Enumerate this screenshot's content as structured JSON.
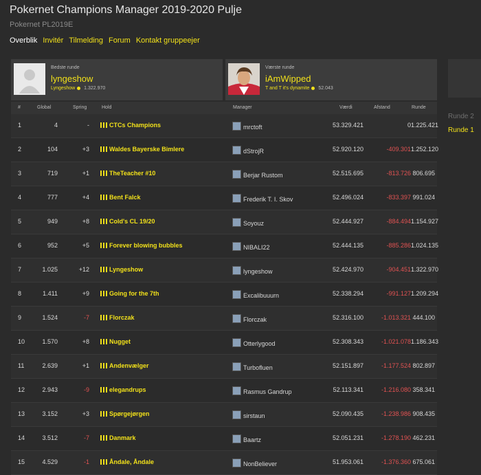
{
  "page": {
    "title": "Pokernet Champions Manager 2019-2020 Pulje",
    "subtitle": "Pokernet PL2019E"
  },
  "nav": {
    "items": [
      "Overblik",
      "Invitér",
      "Tilmelding",
      "Forum",
      "Kontakt gruppeejer"
    ]
  },
  "best": {
    "label": "Bedste runde",
    "name": "lyngeshow",
    "team": "Lyngeshow",
    "points": "1.322.970"
  },
  "worst": {
    "label": "Værste runde",
    "name": "iAmWipped",
    "team": "T and T it's dynamite",
    "points": "52.043"
  },
  "rounds": {
    "round2": "Runde 2",
    "round1": "Runde 1"
  },
  "table": {
    "headers": {
      "rank": "#",
      "global": "Global",
      "spring": "Spring",
      "team": "Hold",
      "manager": "Manager",
      "value": "Værdi",
      "gap": "Afstand",
      "round": "Runde"
    },
    "rows": [
      {
        "rank": "1",
        "global": "4",
        "spring": "-",
        "team": "CTCs Champions",
        "manager": "mrctoft",
        "value": "53.329.421",
        "gap": "0",
        "round": "1.225.421"
      },
      {
        "rank": "2",
        "global": "104",
        "spring": "+3",
        "team": "Waldes Bayerske Bimlere",
        "manager": "dStrojR",
        "value": "52.920.120",
        "gap": "-409.301",
        "round": "1.252.120"
      },
      {
        "rank": "3",
        "global": "719",
        "spring": "+1",
        "team": "TheTeacher #10",
        "manager": "Berjar Rustom",
        "value": "52.515.695",
        "gap": "-813.726",
        "round": "806.695"
      },
      {
        "rank": "4",
        "global": "777",
        "spring": "+4",
        "team": "Bent Falck",
        "manager": "Frederik T. I. Skov",
        "value": "52.496.024",
        "gap": "-833.397",
        "round": "991.024"
      },
      {
        "rank": "5",
        "global": "949",
        "spring": "+8",
        "team": "Cold's CL 19/20",
        "manager": "Soyouz",
        "value": "52.444.927",
        "gap": "-884.494",
        "round": "1.154.927"
      },
      {
        "rank": "6",
        "global": "952",
        "spring": "+5",
        "team": "Forever blowing bubbles",
        "manager": "NIBALI22",
        "value": "52.444.135",
        "gap": "-885.286",
        "round": "1.024.135"
      },
      {
        "rank": "7",
        "global": "1.025",
        "spring": "+12",
        "team": "Lyngeshow",
        "manager": "lyngeshow",
        "value": "52.424.970",
        "gap": "-904.451",
        "round": "1.322.970"
      },
      {
        "rank": "8",
        "global": "1.411",
        "spring": "+9",
        "team": "Going for the 7th",
        "manager": "Excalibuuurn",
        "value": "52.338.294",
        "gap": "-991.127",
        "round": "1.209.294"
      },
      {
        "rank": "9",
        "global": "1.524",
        "spring": "-7",
        "team": "Florczak",
        "manager": "Florczak",
        "value": "52.316.100",
        "gap": "-1.013.321",
        "round": "444.100"
      },
      {
        "rank": "10",
        "global": "1.570",
        "spring": "+8",
        "team": "Nugget",
        "manager": "Otterlygood",
        "value": "52.308.343",
        "gap": "-1.021.078",
        "round": "1.186.343"
      },
      {
        "rank": "11",
        "global": "2.639",
        "spring": "+1",
        "team": "Andenvælger",
        "manager": "Turbofluen",
        "value": "52.151.897",
        "gap": "-1.177.524",
        "round": "802.897"
      },
      {
        "rank": "12",
        "global": "2.943",
        "spring": "-9",
        "team": "elegandrups",
        "manager": "Rasmus Gandrup",
        "value": "52.113.341",
        "gap": "-1.216.080",
        "round": "358.341"
      },
      {
        "rank": "13",
        "global": "3.152",
        "spring": "+3",
        "team": "Spørgejørgen",
        "manager": "sirstaun",
        "value": "52.090.435",
        "gap": "-1.238.986",
        "round": "908.435"
      },
      {
        "rank": "14",
        "global": "3.512",
        "spring": "-7",
        "team": "Danmark",
        "manager": "Baartz",
        "value": "52.051.231",
        "gap": "-1.278.190",
        "round": "462.231"
      },
      {
        "rank": "15",
        "global": "4.529",
        "spring": "-1",
        "team": "Åndale, Åndale",
        "manager": "NonBeliever",
        "value": "51.953.061",
        "gap": "-1.376.360",
        "round": "675.061"
      }
    ]
  },
  "colors": {
    "accent": "#f2e11a",
    "negative": "#e05252",
    "background": "#2b2b2b"
  },
  "icons": {
    "team": "bar-chart-icon",
    "manager": "avatar-icon"
  }
}
